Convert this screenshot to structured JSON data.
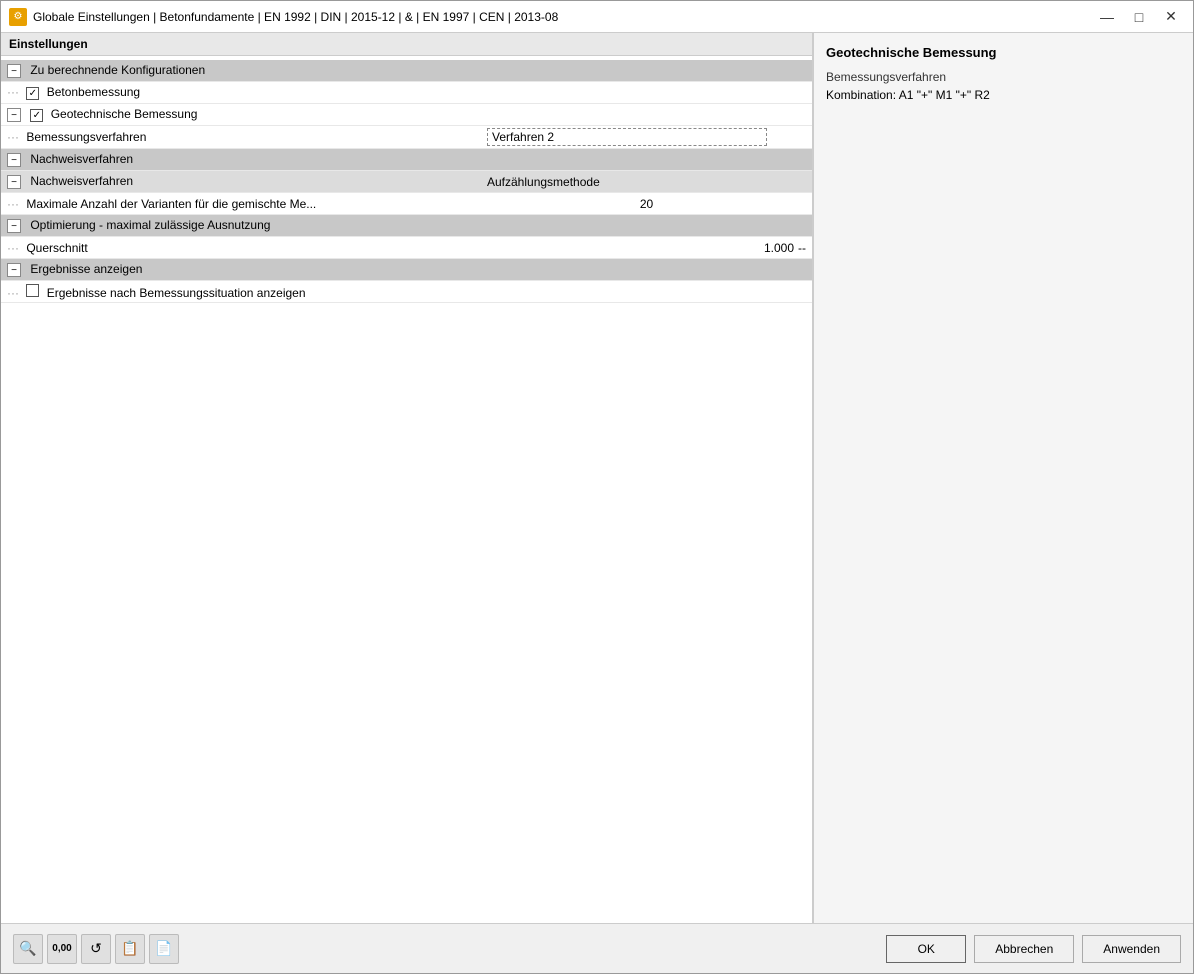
{
  "window": {
    "title": "Globale Einstellungen | Betonfundamente | EN 1992 | DIN | 2015-12 | & | EN 1997 | CEN | 2013-08",
    "icon": "⚙"
  },
  "titlebar": {
    "minimize": "—",
    "maximize": "□",
    "close": "✕"
  },
  "left_panel": {
    "header": "Einstellungen",
    "sections": [
      {
        "label": "Zu berechnende Konfigurationen",
        "collapse_symbol": "−",
        "items": [
          {
            "type": "checkbox-item",
            "label": "Betonbemessung",
            "checked": true,
            "indent": 2
          },
          {
            "type": "checkbox-expand",
            "label": "Geotechnische Bemessung",
            "checked": true,
            "indent": 2,
            "children": [
              {
                "label": "Bemessungsverfahren",
                "value": "Verfahren 2",
                "has_input": true
              }
            ]
          }
        ]
      },
      {
        "label": "Nachweisverfahren",
        "collapse_symbol": "−",
        "items": [
          {
            "type": "subsection",
            "label": "Nachweisverfahren",
            "value": "Aufzählungsmethode",
            "children": [
              {
                "label": "Maximale Anzahl der Varianten für die gemischte Me...",
                "value": "20"
              }
            ]
          }
        ]
      },
      {
        "label": "Optimierung - maximal zulässige Ausnutzung",
        "collapse_symbol": "−",
        "items": [
          {
            "label": "Querschnitt",
            "value": "1.000",
            "unit": "--"
          }
        ]
      },
      {
        "label": "Ergebnisse anzeigen",
        "collapse_symbol": "−",
        "items": [
          {
            "type": "checkbox-item",
            "label": "Ergebnisse nach Bemessungssituation anzeigen",
            "checked": false
          }
        ]
      }
    ]
  },
  "right_panel": {
    "title": "Geotechnische Bemessung",
    "label1": "Bemessungsverfahren",
    "label2": "Kombination: A1 \"+\" M1 \"+\" R2"
  },
  "toolbar": {
    "icons": [
      "🔍",
      "0,00",
      "🔄",
      "📋",
      "📄"
    ]
  },
  "buttons": {
    "ok": "OK",
    "cancel": "Abbrechen",
    "apply": "Anwenden"
  }
}
